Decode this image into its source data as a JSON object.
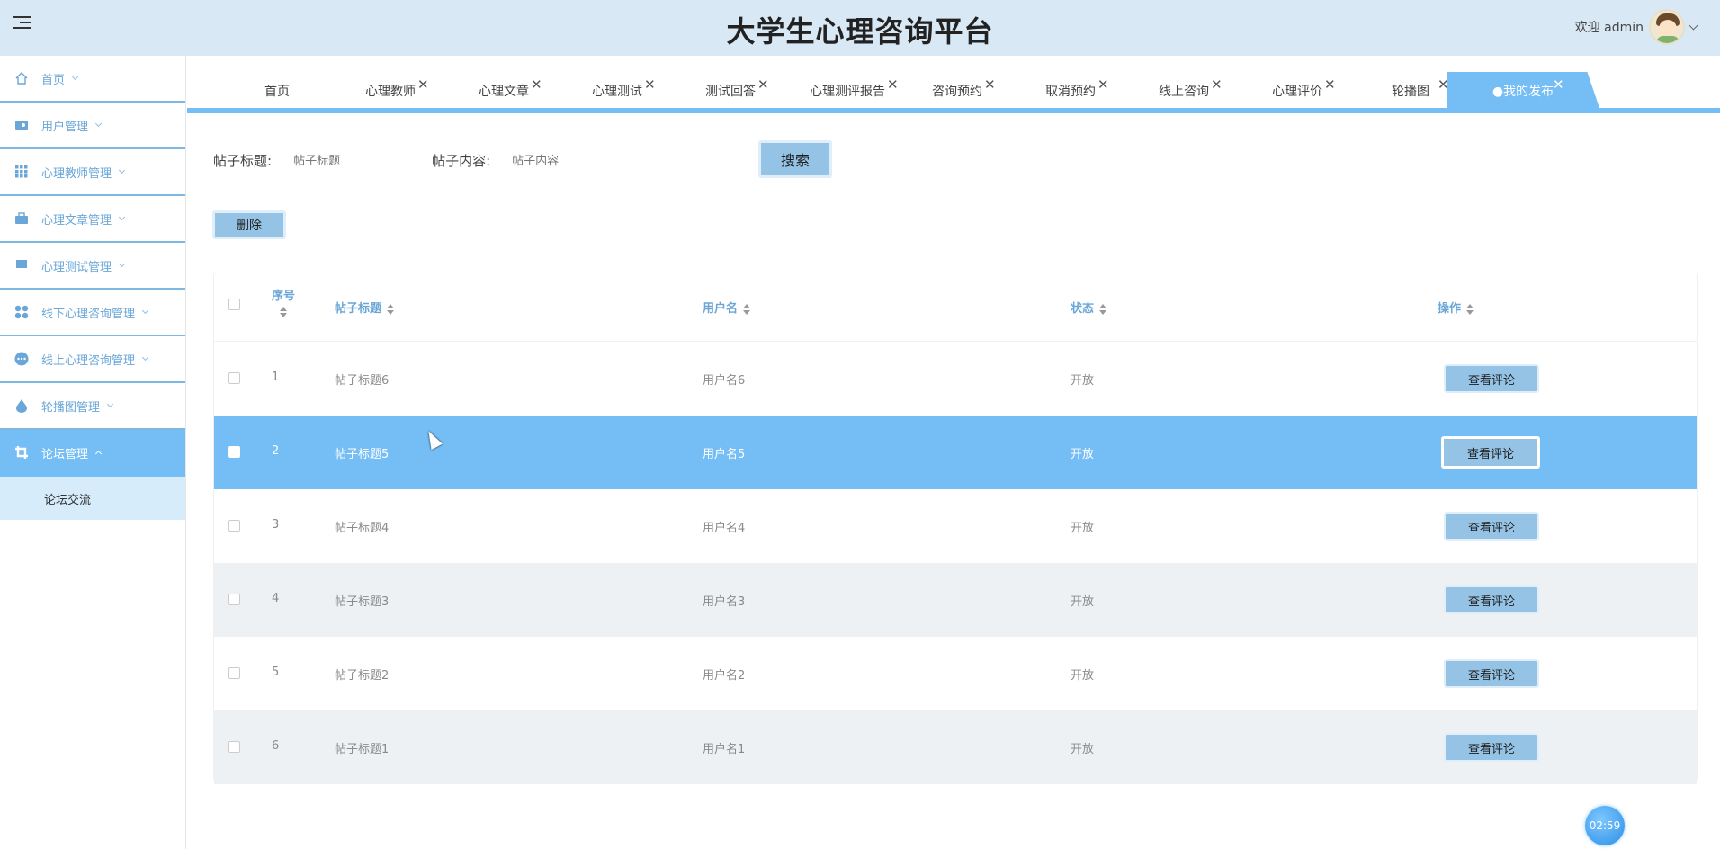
{
  "header": {
    "title": "大学生心理咨询平台",
    "welcome": "欢迎 admin"
  },
  "sidebar": {
    "items": [
      {
        "label": "首页",
        "icon": "home-icon"
      },
      {
        "label": "用户管理",
        "icon": "id-card-icon"
      },
      {
        "label": "心理教师管理",
        "icon": "grid-icon"
      },
      {
        "label": "心理文章管理",
        "icon": "briefcase-icon"
      },
      {
        "label": "心理测试管理",
        "icon": "monitor-icon"
      },
      {
        "label": "线下心理咨询管理",
        "icon": "apps-icon"
      },
      {
        "label": "线上心理咨询管理",
        "icon": "chat-icon"
      },
      {
        "label": "轮播图管理",
        "icon": "drop-icon"
      },
      {
        "label": "论坛管理",
        "icon": "crop-icon"
      }
    ],
    "sub_item": "论坛交流"
  },
  "tabs": [
    "首页",
    "心理教师",
    "心理文章",
    "心理测试",
    "测试回答",
    "心理测评报告",
    "咨询预约",
    "取消预约",
    "线上咨询",
    "心理评价",
    "轮播图",
    "●我的发布"
  ],
  "search": {
    "title_label": "帖子标题:",
    "title_placeholder": "帖子标题",
    "content_label": "帖子内容:",
    "content_placeholder": "帖子内容",
    "button": "搜索"
  },
  "actions": {
    "delete": "删除"
  },
  "table": {
    "headers": [
      "序号",
      "帖子标题",
      "用户名",
      "状态",
      "操作"
    ],
    "rows": [
      {
        "no": "1",
        "title": "帖子标题6",
        "user": "用户名6",
        "status": "开放",
        "action": "查看评论"
      },
      {
        "no": "2",
        "title": "帖子标题5",
        "user": "用户名5",
        "status": "开放",
        "action": "查看评论"
      },
      {
        "no": "3",
        "title": "帖子标题4",
        "user": "用户名4",
        "status": "开放",
        "action": "查看评论"
      },
      {
        "no": "4",
        "title": "帖子标题3",
        "user": "用户名3",
        "status": "开放",
        "action": "查看评论"
      },
      {
        "no": "5",
        "title": "帖子标题2",
        "user": "用户名2",
        "status": "开放",
        "action": "查看评论"
      },
      {
        "no": "6",
        "title": "帖子标题1",
        "user": "用户名1",
        "status": "开放",
        "action": "查看评论"
      }
    ]
  },
  "timer": "02:59",
  "colors": {
    "accent": "#74bdf5",
    "button": "#95c3e6",
    "header_bg": "#d9e8f5",
    "link": "#6aa6d8"
  }
}
